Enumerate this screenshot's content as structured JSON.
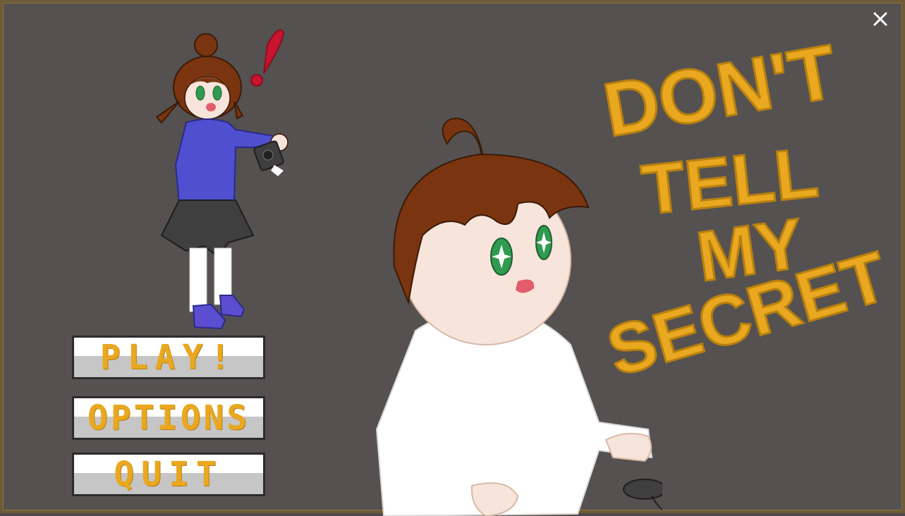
{
  "title": {
    "line1": "DON'T",
    "line2": "TELL",
    "line3": "MY",
    "line4": "SECRET"
  },
  "menu": {
    "play_label": "PLAY!",
    "options_label": "OPTIONS",
    "quit_label": "QUIT"
  },
  "colors": {
    "accent": "#e9a81f",
    "background": "#555150",
    "frame": "#6e5a36"
  },
  "icons": {
    "close": "close-icon"
  }
}
